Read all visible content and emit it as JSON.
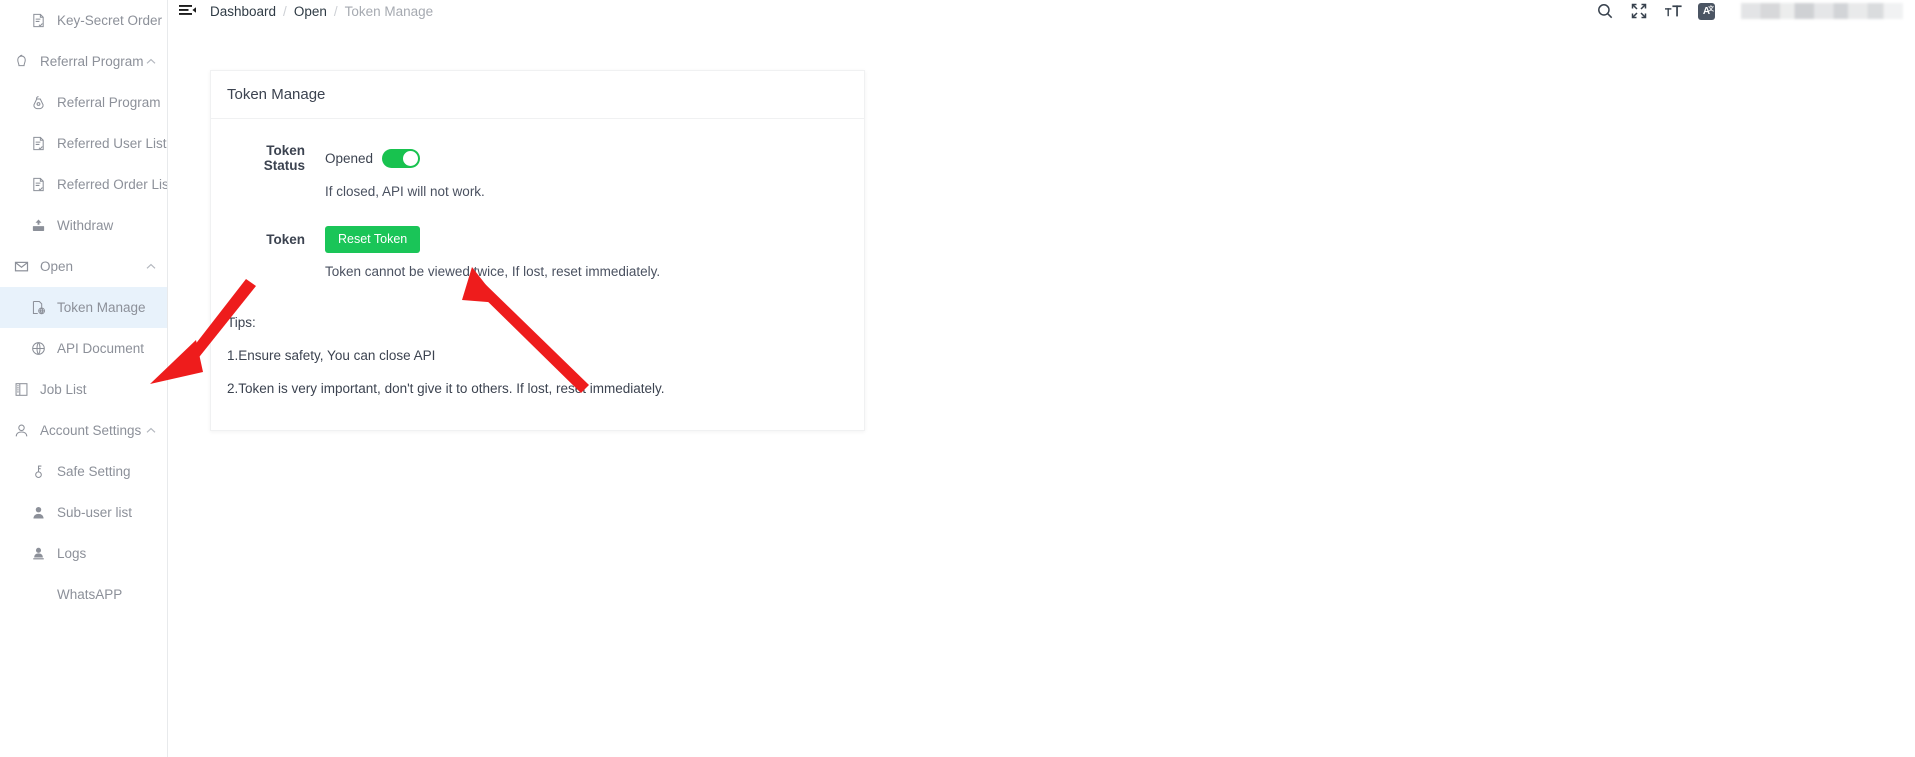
{
  "sidebar": {
    "items": [
      {
        "label": "Key-Secret Order",
        "icon": "file-order-icon",
        "level": "child",
        "active": false,
        "caret": ""
      },
      {
        "label": "Referral Program",
        "icon": "gift-icon",
        "level": "group",
        "active": false,
        "caret": "^"
      },
      {
        "label": "Referral Program",
        "icon": "bag-icon",
        "level": "child",
        "active": false,
        "caret": ""
      },
      {
        "label": "Referred User List",
        "icon": "file-order-icon",
        "level": "child",
        "active": false,
        "caret": ""
      },
      {
        "label": "Referred Order List",
        "icon": "file-order-icon",
        "level": "child",
        "active": false,
        "caret": ""
      },
      {
        "label": "Withdraw",
        "icon": "withdraw-icon",
        "level": "child",
        "active": false,
        "caret": ""
      },
      {
        "label": "Open",
        "icon": "mail-icon",
        "level": "group",
        "active": false,
        "caret": "^"
      },
      {
        "label": "Token Manage",
        "icon": "token-icon",
        "level": "child",
        "active": true,
        "caret": ""
      },
      {
        "label": "API Document",
        "icon": "globe-icon",
        "level": "child",
        "active": false,
        "caret": ""
      },
      {
        "label": "Job List",
        "icon": "book-icon",
        "level": "plain",
        "active": false,
        "caret": ""
      },
      {
        "label": "Account Settings",
        "icon": "user-outline-icon",
        "level": "group",
        "active": false,
        "caret": "^"
      },
      {
        "label": "Safe Setting",
        "icon": "key-icon",
        "level": "child",
        "active": false,
        "caret": ""
      },
      {
        "label": "Sub-user list",
        "icon": "user-solid-icon",
        "level": "child",
        "active": false,
        "caret": ""
      },
      {
        "label": "Logs",
        "icon": "user-log-icon",
        "level": "child",
        "active": false,
        "caret": ""
      },
      {
        "label": "WhatsAPP",
        "icon": "",
        "level": "noicon",
        "active": false,
        "caret": ""
      }
    ]
  },
  "header": {
    "menu_toggle": "menu-fold-icon",
    "breadcrumb": [
      {
        "label": "Dashboard",
        "current": false
      },
      {
        "label": "Open",
        "current": false
      },
      {
        "label": "Token Manage",
        "current": true
      }
    ],
    "separator": "/",
    "icons": [
      {
        "name": "search-icon",
        "glyph": "search"
      },
      {
        "name": "fullscreen-icon",
        "glyph": "fullscreen"
      },
      {
        "name": "font-size-icon",
        "glyph": "text-size"
      },
      {
        "name": "translate-icon",
        "glyph": "A",
        "sup": "文"
      }
    ],
    "user_area": "blurred-user-account"
  },
  "card": {
    "title": "Token Manage",
    "token_status": {
      "label": "Token Status",
      "value_text": "Opened",
      "toggle_on": true,
      "hint": "If closed, API will not work."
    },
    "token": {
      "label": "Token",
      "button_label": "Reset Token",
      "hint": "Token cannot be viewed twice, If lost, reset immediately."
    },
    "tips": {
      "heading": "Tips:",
      "lines": [
        "1.Ensure safety, You can close API",
        "2.Token is very important, don't give it to others. If lost, reset immediately."
      ]
    }
  },
  "colors": {
    "accent_green": "#1ac558",
    "toggle_green": "#18c24f",
    "active_nav_bg": "#e8f2fb",
    "annotation_red": "#ee1c1c",
    "text_primary": "#3c4350",
    "text_muted": "#8c9099"
  }
}
